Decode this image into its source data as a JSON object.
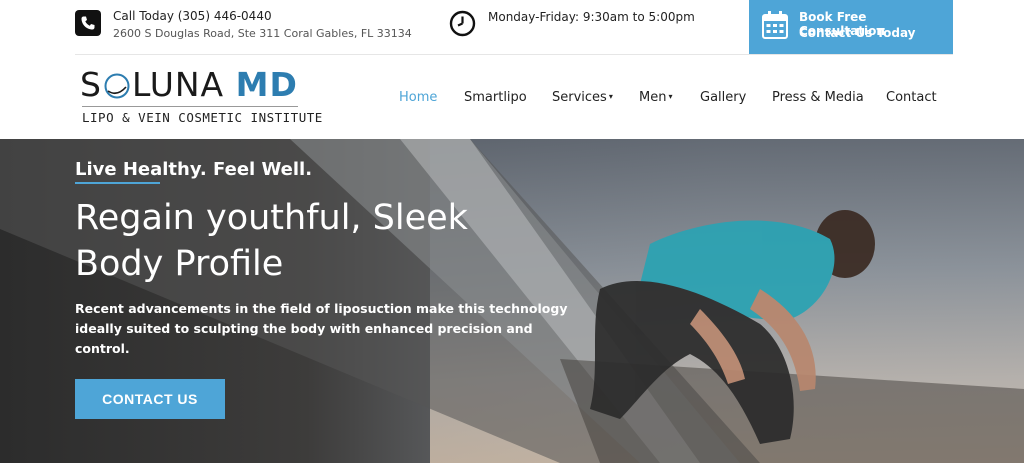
{
  "topbar": {
    "phone": "Call Today (305) 446-0440",
    "address": "2600 S Douglas Road, Ste 311 Coral Gables, FL 33134",
    "hours": "Monday-Friday: 9:30am to 5:00pm",
    "consult_line1": "Book Free Consultation",
    "consult_line2": "Contact Us Today",
    "consult_color": "#4ea5d7"
  },
  "logo": {
    "name_part1": "S",
    "name_part2": "LUNA ",
    "name_md": "MD",
    "tagline": "LIPO & VEIN COSMETIC INSTITUTE"
  },
  "nav": {
    "items": [
      {
        "label": "Home",
        "active": true
      },
      {
        "label": "Smartlipo"
      },
      {
        "label": "Services",
        "caret": "▾"
      },
      {
        "label": "Men",
        "caret": "▾"
      },
      {
        "label": "Gallery"
      },
      {
        "label": "Press & Media"
      },
      {
        "label": "Contact"
      }
    ]
  },
  "hero": {
    "kicker": "Live Healthy. Feel Well.",
    "headline": "Regain youthful, Sleek Body Profile",
    "body": "Recent advancements in the field of liposuction make this technology ideally suited to sculpting the body with enhanced precision and control.",
    "cta": "CONTACT US"
  },
  "colors": {
    "accent": "#4ea5d7",
    "logo_md": "#2d7db0"
  }
}
